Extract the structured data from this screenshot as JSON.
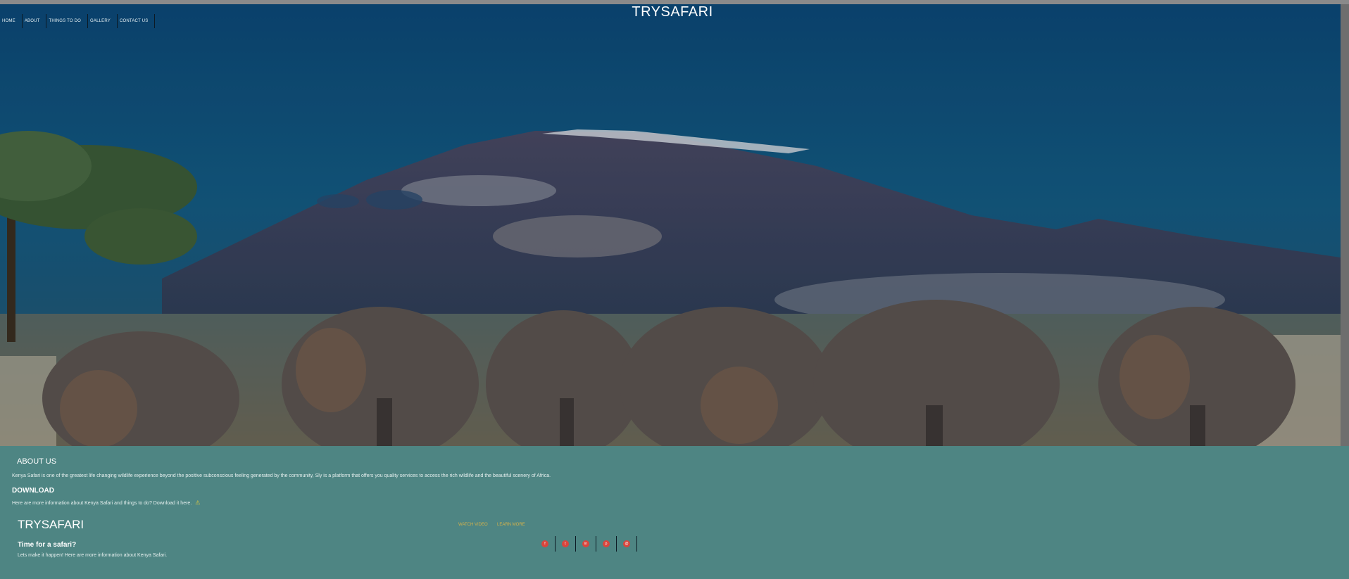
{
  "site": {
    "title": "TRYSAFARI"
  },
  "nav": {
    "items": [
      "HOME",
      "ABOUT",
      "THINGS TO DO",
      "GALLERY",
      "CONTACT US"
    ]
  },
  "about": {
    "title": "ABOUT US",
    "text": "Kenya Safari is one of the greatest life changing wildlife experience beyond the positive subconscious feeling generated by the community, Sly is a platform that offers you quality services to access the rich wildlife and the beautiful scenery of Africa."
  },
  "download": {
    "title": "DOWNLOAD",
    "text": "Here are more information about Kenya Safari and things to do? Download it here.",
    "icon": "download-warning-icon"
  },
  "footer": {
    "brand": "TRYSAFARI",
    "tagline": "Time for a safari?",
    "text": "Lets make it happen! Here are more information about Kenya Safari.",
    "watch_video": "WATCH VIDEO",
    "learn_more": "LEARN MORE",
    "socials": [
      {
        "icon": "facebook-icon",
        "glyph": "f"
      },
      {
        "icon": "twitter-icon",
        "glyph": "t"
      },
      {
        "icon": "linkedin-icon",
        "glyph": "in"
      },
      {
        "icon": "pinterest-icon",
        "glyph": "p"
      },
      {
        "icon": "email-icon",
        "glyph": "@"
      }
    ]
  },
  "colors": {
    "section_bg": "#4e8583",
    "link": "#d5b24a",
    "social_bg": "#d9453d",
    "sky_top": "#0c4a7a"
  }
}
